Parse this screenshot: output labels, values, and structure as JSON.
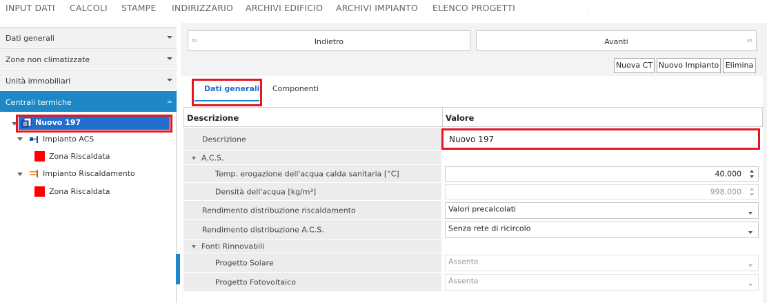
{
  "top_menu": [
    "INPUT DATI",
    "CALCOLI",
    "STAMPE",
    "INDIRIZZARIO",
    "ARCHIVI EDIFICIO",
    "ARCHIVI IMPIANTO",
    "ELENCO PROGETTI"
  ],
  "sidebar": {
    "sections": [
      {
        "label": "Dati generali"
      },
      {
        "label": "Zone non climatizzate"
      },
      {
        "label": "Unità immobiliari"
      },
      {
        "label": "Centrali termiche"
      }
    ],
    "tree": {
      "root": "Nuovo 197",
      "impianto_acs": "Impianto ACS",
      "zona_1": "Zona Riscaldata",
      "impianto_risc": "Impianto Riscaldamento",
      "zona_2": "Zona Riscaldata"
    }
  },
  "nav": {
    "back": "Indietro",
    "forward": "Avanti"
  },
  "actions": {
    "nuova_ct": "Nuova CT",
    "nuovo_impianto": "Nuovo Impianto",
    "elimina": "Elimina"
  },
  "tabs": {
    "dati_generali": "Dati generali",
    "componenti": "Componenti"
  },
  "grid": {
    "header_desc": "Descrizione",
    "header_val": "Valore",
    "descrizione_label": "Descrizione",
    "descrizione_value": "Nuovo 197",
    "acs_group": "A.C.S.",
    "temp_label": "Temp. erogazione dell'acqua calda sanitaria [°C]",
    "temp_value": "40.000",
    "dens_label": "Densità dell'acqua [kg/m³]",
    "dens_value": "998.000",
    "rend_risc_label": "Rendimento distribuzione riscaldamento",
    "rend_risc_value": "Valori precalcolati",
    "rend_acs_label": "Rendimento distribuzione A.C.S.",
    "rend_acs_value": "Senza rete di ricircolo",
    "fonti_group": "Fonti Rinnovabili",
    "solare_label": "Progetto Solare",
    "solare_value": "Assente",
    "fotov_label": "Progetto Fotovoltaico",
    "fotov_value": "Assente"
  },
  "colors": {
    "accent": "#1e88c7",
    "selection": "#1e6fd0",
    "highlight_box": "#e8141e"
  }
}
